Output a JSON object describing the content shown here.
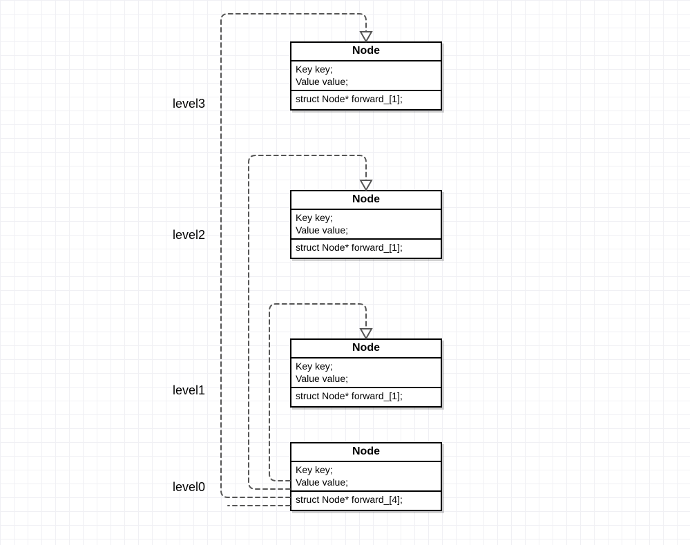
{
  "labels": {
    "level3": "level3",
    "level2": "level2",
    "level1": "level1",
    "level0": "level0"
  },
  "nodes": {
    "n3": {
      "title": "Node",
      "attr1": "Key key;",
      "attr2": "Value value;",
      "op1": "struct Node* forward_[1];"
    },
    "n2": {
      "title": "Node",
      "attr1": "Key key;",
      "attr2": "Value value;",
      "op1": "struct Node* forward_[1];"
    },
    "n1": {
      "title": "Node",
      "attr1": "Key key;",
      "attr2": "Value value;",
      "op1": "struct Node* forward_[1];"
    },
    "n0": {
      "title": "Node",
      "attr1": "Key key;",
      "attr2": "Value value;",
      "op1": "struct Node* forward_[4];"
    }
  }
}
